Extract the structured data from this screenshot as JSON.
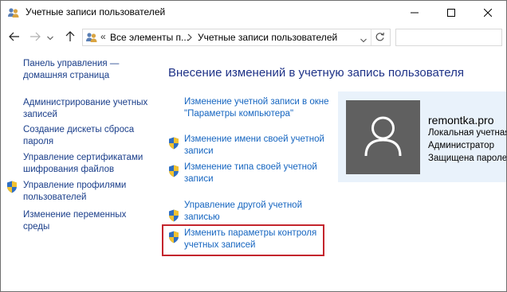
{
  "window": {
    "title": "Учетные записи пользователей"
  },
  "nav": {
    "breadcrumb_prefix": "«",
    "crumbs": [
      "Все элементы п...",
      "Учетные записи пользователей"
    ],
    "search_placeholder": ""
  },
  "sidebar": {
    "items": [
      {
        "label_lines": [
          "Панель управления —",
          "домашняя страница"
        ]
      },
      {
        "label_lines": [
          "Администрирование учетных",
          "записей"
        ]
      },
      {
        "label_lines": [
          "Создание дискеты сброса",
          "пароля"
        ]
      },
      {
        "label_lines": [
          "Управление сертификатами",
          "шифрования файлов"
        ]
      },
      {
        "label_lines": [
          "Управление профилями",
          "пользователей"
        ]
      },
      {
        "label_lines": [
          "Изменение переменных",
          "среды"
        ]
      }
    ]
  },
  "main": {
    "title": "Внесение изменений в учетную запись пользователя",
    "links": [
      {
        "lines": [
          "Изменение учетной записи в окне",
          "\"Параметры компьютера\""
        ]
      },
      {
        "lines": [
          "Изменение имени своей учетной",
          "записи"
        ]
      },
      {
        "lines": [
          "Изменение типа своей учетной",
          "записи"
        ]
      },
      {
        "lines": [
          "Управление другой учетной",
          "записью"
        ]
      },
      {
        "lines": [
          "Изменить параметры контроля",
          "учетных записей"
        ]
      }
    ]
  },
  "user": {
    "name": "remontka.pro",
    "details": [
      "Локальная учетная",
      "Администратор",
      "Защищена паролем"
    ]
  },
  "colors": {
    "link": "#1565c0",
    "sidebar_link": "#1a3e8a",
    "heading": "#1e3287",
    "highlight": "#c4252d",
    "user_panel": "#e9f2fb",
    "avatar_bg": "#606060"
  },
  "icons": {
    "title": "users-icon",
    "shield": "uac-shield-icon",
    "avatar": "user-silhouette-icon"
  }
}
